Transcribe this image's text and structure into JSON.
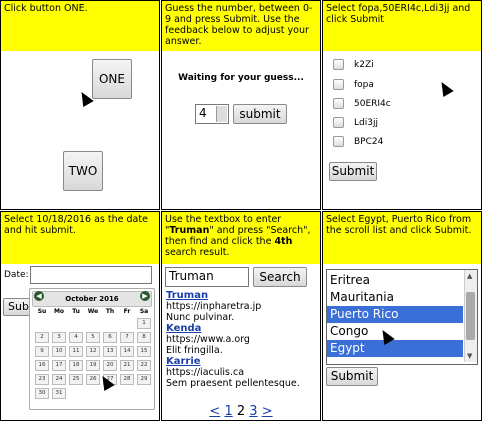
{
  "cells": {
    "c1": {
      "instruction": "Click button ONE.",
      "buttons": {
        "one": "ONE",
        "two": "TWO"
      }
    },
    "c2": {
      "instruction": "Guess the number, between 0-9 and press Submit. Use the feedback below to adjust your answer.",
      "feedback": "Waiting for your guess...",
      "input_value": "4",
      "submit_label": "submit"
    },
    "c3": {
      "instruction": "Select fopa,50ERI4c,Ldi3jj and click Submit",
      "options": [
        "k2Zi",
        "fopa",
        "50ERI4c",
        "Ldi3jj",
        "BPC24"
      ],
      "submit_label": "Submit"
    },
    "c4": {
      "instruction": "Select 10/18/2016 as the date and hit submit.",
      "date_label": "Date:",
      "submit_partial": "Sub",
      "calendar": {
        "month_title": "October 2016",
        "prev": "◀",
        "next": "▶",
        "dow": [
          "Su",
          "Mo",
          "Tu",
          "We",
          "Th",
          "Fr",
          "Sa"
        ],
        "days": [
          "1",
          "2",
          "3",
          "4",
          "5",
          "6",
          "7",
          "8",
          "9",
          "10",
          "11",
          "12",
          "13",
          "14",
          "15",
          "16",
          "17",
          "18",
          "19",
          "20",
          "21",
          "22",
          "23",
          "24",
          "25",
          "26",
          "27",
          "28",
          "29",
          "30",
          "31"
        ]
      }
    },
    "c5": {
      "instruction_pre": "Use the textbox to enter \"",
      "instruction_bold1": "Truman",
      "instruction_mid": "\" and press \"Search\", then find and click the ",
      "instruction_bold2": "4th",
      "instruction_post": " search result.",
      "search_value": "Truman",
      "search_label": "Search",
      "results": [
        {
          "title": "Truman",
          "url": "https://inpharetra.jp",
          "desc": "Nunc pulvinar."
        },
        {
          "title": "Kenda",
          "url": "https://www.a.org",
          "desc": "Elit fringilla."
        },
        {
          "title": "Karrie",
          "url": "https://iaculis.ca",
          "desc": "Sem praesent pellentesque."
        }
      ],
      "pager": {
        "prev": "<",
        "p1": "1",
        "p2": "2",
        "p3": "3",
        "next": ">"
      }
    },
    "c6": {
      "instruction": "Select Egypt, Puerto Rico from the scroll list and click Submit.",
      "list": [
        {
          "label": "Eritrea",
          "selected": false
        },
        {
          "label": "Mauritania",
          "selected": false
        },
        {
          "label": "Puerto Rico",
          "selected": true
        },
        {
          "label": "Congo",
          "selected": false
        },
        {
          "label": "Egypt",
          "selected": true
        }
      ],
      "submit_label": "Submit"
    }
  }
}
